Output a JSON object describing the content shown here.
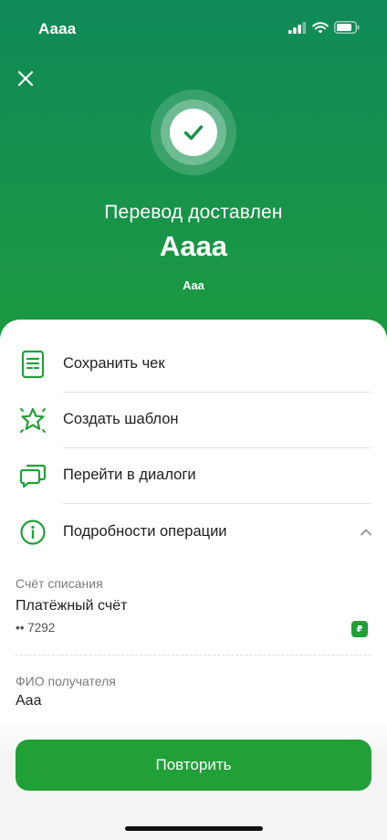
{
  "status_bar": {
    "time": "Aaaa",
    "icons": [
      "cellular-signal-icon",
      "wifi-icon",
      "battery-icon"
    ]
  },
  "header": {
    "close_icon": "close-icon",
    "success_icon": "checkmark-icon",
    "title": "Перевод доставлен",
    "recipient_name": "Aaaa",
    "subtitle": "Aaa"
  },
  "actions": [
    {
      "icon": "receipt-icon",
      "label": "Сохранить чек"
    },
    {
      "icon": "star-template-icon",
      "label": "Создать шаблон"
    },
    {
      "icon": "chat-dialogs-icon",
      "label": "Перейти в диалоги"
    },
    {
      "icon": "info-icon",
      "label": "Подробности операции",
      "expanded": true
    }
  ],
  "details": {
    "debit_account_label": "Счёт списания",
    "debit_account_name": "Платёжный счёт",
    "debit_account_number": "•• 7292",
    "currency_badge": "₽",
    "recipient_label": "ФИО получателя",
    "recipient_value": "Aaa"
  },
  "primary_button": {
    "label": "Повторить"
  },
  "colors": {
    "brand_green": "#21a038",
    "hero_top": "#0f8a59",
    "hero_bottom": "#1c9a3f",
    "text_primary": "#1f1f1f",
    "text_secondary": "#7b7b7b"
  }
}
